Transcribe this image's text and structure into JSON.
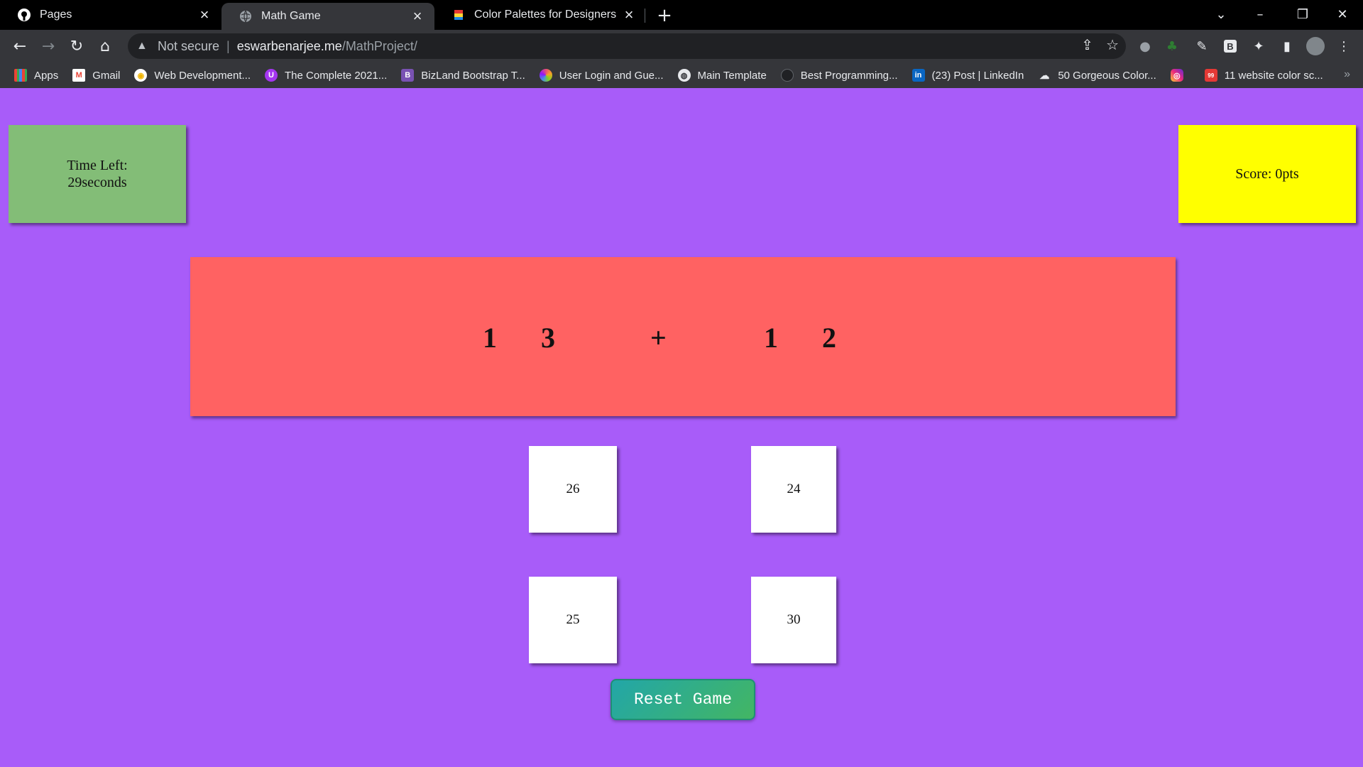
{
  "browser": {
    "tabs": [
      {
        "title": "Pages",
        "icon": "github-icon"
      },
      {
        "title": "Math Game",
        "icon": "globe-icon",
        "active": true
      },
      {
        "title": "Color Palettes for Designers and",
        "icon": "palette-icon"
      }
    ],
    "address": {
      "security_label": "Not secure",
      "host": "eswarbenarjee.me",
      "path": "/MathProject/"
    },
    "bookmarks": [
      {
        "label": "Apps",
        "icon": "apps-grid-icon",
        "color": "#4285f4"
      },
      {
        "label": "Gmail",
        "icon": "gmail-icon",
        "color": "#ea4335"
      },
      {
        "label": "Web Development...",
        "icon": "udemy-icon",
        "color": "#f0b400"
      },
      {
        "label": "The Complete 2021...",
        "icon": "udemy-purple-icon",
        "color": "#a435f0"
      },
      {
        "label": "BizLand Bootstrap T...",
        "icon": "bootstrap-icon",
        "color": "#7952b3"
      },
      {
        "label": "User Login and Gue...",
        "icon": "colorwheel-icon",
        "color": "#e94e77"
      },
      {
        "label": "Main Template",
        "icon": "globe-icon",
        "color": "#9aa0a6"
      },
      {
        "label": "Best Programming...",
        "icon": "dark-circle-icon",
        "color": "#202124"
      },
      {
        "label": "(23) Post | LinkedIn",
        "icon": "linkedin-icon",
        "color": "#0a66c2"
      },
      {
        "label": "50 Gorgeous Color...",
        "icon": "cloud-icon",
        "color": "#5f6368"
      },
      {
        "label": "",
        "icon": "instagram-icon",
        "color": "#d6249f"
      },
      {
        "label": "11 website color sc...",
        "icon": "site-icon",
        "color": "#e53935"
      }
    ],
    "more_bookmarks": "»"
  },
  "game": {
    "time_label": "Time Left:",
    "time_value": "29seconds",
    "score_text": "Score: 0pts",
    "question": {
      "a1": "1",
      "a2": "3",
      "op": "+",
      "b1": "1",
      "b2": "2"
    },
    "choices": [
      "26",
      "24",
      "25",
      "30"
    ],
    "reset_label": "Reset Game"
  },
  "colors": {
    "background": "#a85cf9",
    "time_box": "#83bd77",
    "score_box": "#ffff00",
    "question_box": "#ff6262"
  }
}
